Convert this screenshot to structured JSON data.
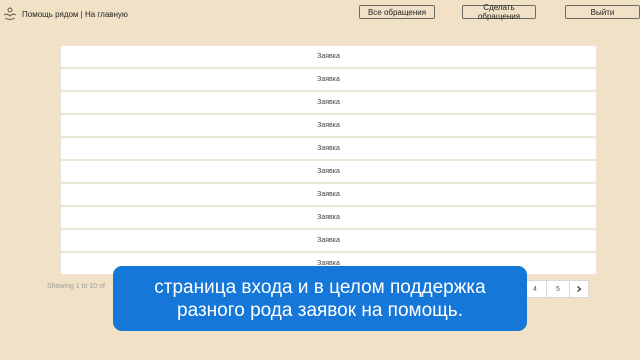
{
  "header": {
    "brand": "Помощь рядом | На главную",
    "buttons": {
      "all": "Все обращения",
      "make": "Сделать обращения",
      "exit": "Выйти"
    }
  },
  "requests": [
    {
      "label": "Заявка"
    },
    {
      "label": "Заявка"
    },
    {
      "label": "Заявка"
    },
    {
      "label": "Заявка"
    },
    {
      "label": "Заявка"
    },
    {
      "label": "Заявка"
    },
    {
      "label": "Заявка"
    },
    {
      "label": "Заявка"
    },
    {
      "label": "Заявка"
    },
    {
      "label": "Заявка"
    }
  ],
  "pagination": {
    "showing": "Showing 1 to 10 of",
    "pages": [
      "4",
      "5"
    ],
    "next_icon": "chevron-right-icon"
  },
  "subtitle": {
    "line1": "страница входа и в целом поддержка",
    "line2": "разного рода заявок на помощь."
  }
}
